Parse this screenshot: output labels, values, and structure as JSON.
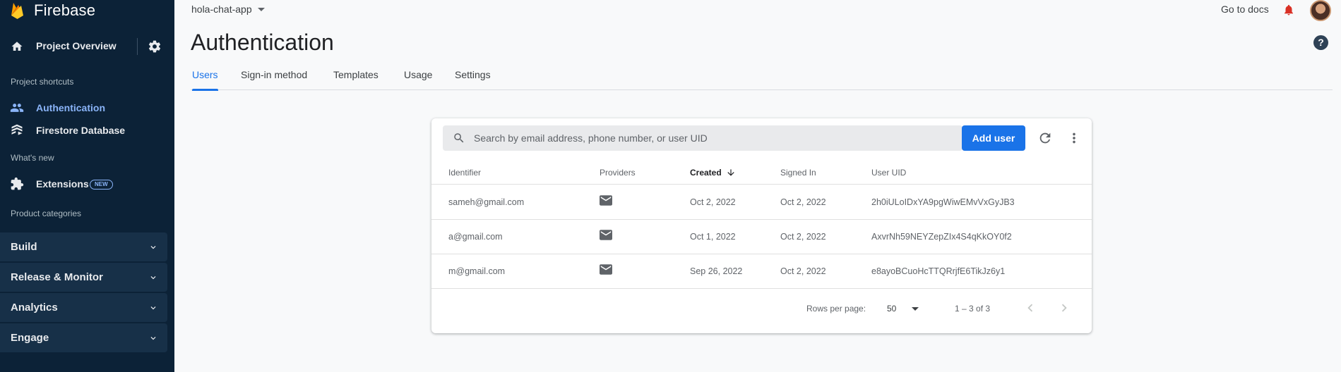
{
  "sidebar": {
    "brand": "Firebase",
    "overview_label": "Project Overview",
    "shortcuts_title": "Project shortcuts",
    "shortcuts": [
      {
        "label": "Authentication"
      },
      {
        "label": "Firestore Database"
      }
    ],
    "whats_new_title": "What's new",
    "extensions_label": "Extensions",
    "new_badge": "NEW",
    "categories_title": "Product categories",
    "categories": [
      {
        "label": "Build"
      },
      {
        "label": "Release & Monitor"
      },
      {
        "label": "Analytics"
      },
      {
        "label": "Engage"
      }
    ]
  },
  "topbar": {
    "project": "hola-chat-app",
    "docs_label": "Go to docs",
    "help_glyph": "?"
  },
  "page": {
    "title": "Authentication",
    "tabs": [
      {
        "label": "Users"
      },
      {
        "label": "Sign-in method"
      },
      {
        "label": "Templates"
      },
      {
        "label": "Usage"
      },
      {
        "label": "Settings"
      }
    ]
  },
  "users": {
    "search_placeholder": "Search by email address, phone number, or user UID",
    "add_user_label": "Add user",
    "columns": [
      "Identifier",
      "Providers",
      "Created",
      "Signed In",
      "User UID"
    ],
    "rows": [
      {
        "identifier": "sameh@gmail.com",
        "provider": "email",
        "created": "Oct 2, 2022",
        "signed_in": "Oct 2, 2022",
        "uid": "2h0iULoIDxYA9pgWiwEMvVxGyJB3"
      },
      {
        "identifier": "a@gmail.com",
        "provider": "email",
        "created": "Oct 1, 2022",
        "signed_in": "Oct 2, 2022",
        "uid": "AxvrNh59NEYZepZIx4S4qKkOY0f2"
      },
      {
        "identifier": "m@gmail.com",
        "provider": "email",
        "created": "Sep 26, 2022",
        "signed_in": "Oct 2, 2022",
        "uid": "e8ayoBCuoHcTTQRrjfE6TikJz6y1"
      }
    ],
    "rows_per_page_label": "Rows per page:",
    "rows_per_page_value": "50",
    "range_text": "1 – 3 of 3"
  },
  "colors": {
    "sidebar_bg": "#0c2237",
    "accent": "#1a73e8",
    "active_nav": "#8ab4f8"
  }
}
